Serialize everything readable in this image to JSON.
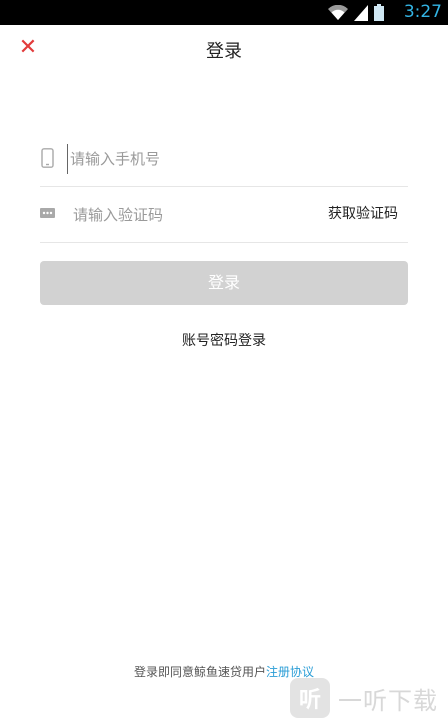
{
  "status_bar": {
    "time": "3:27"
  },
  "header": {
    "close_icon": "close-icon",
    "title": "登录"
  },
  "form": {
    "phone": {
      "icon": "phone-icon",
      "placeholder": "请输入手机号",
      "value": ""
    },
    "code": {
      "icon": "message-icon",
      "placeholder": "请输入验证码",
      "value": "",
      "get_code_label": "获取验证码"
    },
    "login_label": "登录",
    "password_login_label": "账号密码登录"
  },
  "footer": {
    "agreement_text": "登录即同意鲸鱼速贷用户",
    "agreement_link": "注册协议"
  },
  "watermark": {
    "logo_char": "听",
    "text": "一听下载"
  },
  "colors": {
    "accent_close": "#e23b3b",
    "link": "#2a9dd6",
    "button_disabled": "#d2d2d2",
    "status_time": "#33b5e5"
  }
}
